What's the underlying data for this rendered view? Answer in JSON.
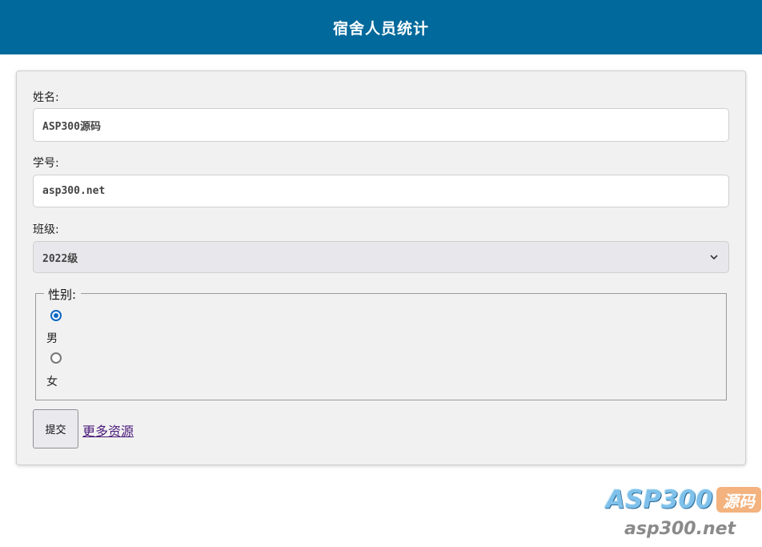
{
  "header": {
    "title": "宿舍人员统计"
  },
  "form": {
    "name": {
      "label": "姓名:",
      "value": "ASP300源码"
    },
    "student_id": {
      "label": "学号:",
      "value": "asp300.net"
    },
    "class": {
      "label": "班级:",
      "selected": "2022级"
    },
    "gender": {
      "legend": "性别:",
      "options": [
        {
          "label": "男",
          "checked": true
        },
        {
          "label": "女",
          "checked": false
        }
      ]
    },
    "submit_label": "提交",
    "more_link_label": "更多资源"
  },
  "watermark": {
    "logo_text": "ASP300",
    "badge_text": "源码",
    "url_text": "asp300.net"
  },
  "colors": {
    "header_bg": "#01699b",
    "radio_accent": "#0b66c3",
    "link": "#4a1a7a"
  }
}
